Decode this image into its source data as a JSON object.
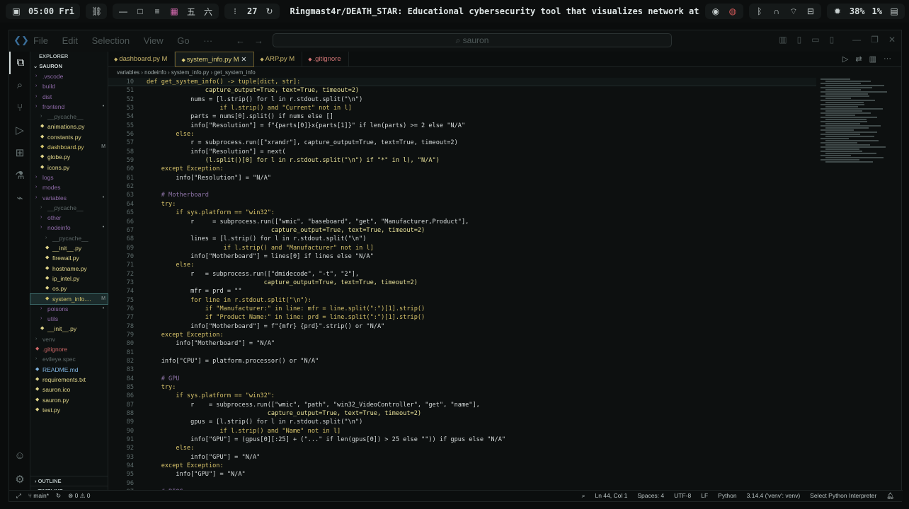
{
  "os_bar": {
    "clock": "05:00 Fri",
    "workspace_number": "27",
    "window_title": "Ringmast4r/DEATH_STAR: Educational cybersecurity tool that visualizes network at…",
    "brightness": "38%",
    "cpu": "1%"
  },
  "titlebar": {
    "menu": [
      "File",
      "Edit",
      "Selection",
      "View",
      "Go",
      "···"
    ],
    "search_text": "sauron"
  },
  "explorer": {
    "header": "EXPLORER",
    "root": "SAURON",
    "items": [
      {
        "label": ".vscode",
        "kind": "dir",
        "indent": 1,
        "mark": ""
      },
      {
        "label": "build",
        "kind": "dir",
        "indent": 1,
        "mark": ""
      },
      {
        "label": "dist",
        "kind": "dir",
        "indent": 1,
        "mark": ""
      },
      {
        "label": "frontend",
        "kind": "dir",
        "indent": 1,
        "mark": "•"
      },
      {
        "label": "__pycache__",
        "kind": "dim",
        "indent": 2,
        "mark": ""
      },
      {
        "label": "animations.py",
        "kind": "py",
        "indent": 2,
        "mark": ""
      },
      {
        "label": "constants.py",
        "kind": "py",
        "indent": 2,
        "mark": ""
      },
      {
        "label": "dashboard.py",
        "kind": "mod",
        "indent": 2,
        "mark": "M"
      },
      {
        "label": "globe.py",
        "kind": "py",
        "indent": 2,
        "mark": ""
      },
      {
        "label": "icons.py",
        "kind": "py",
        "indent": 2,
        "mark": ""
      },
      {
        "label": "logs",
        "kind": "dir",
        "indent": 1,
        "mark": ""
      },
      {
        "label": "modes",
        "kind": "dir",
        "indent": 1,
        "mark": ""
      },
      {
        "label": "variables",
        "kind": "dir",
        "indent": 1,
        "mark": "•"
      },
      {
        "label": "__pycache__",
        "kind": "dim",
        "indent": 2,
        "mark": ""
      },
      {
        "label": "other",
        "kind": "dir",
        "indent": 2,
        "mark": ""
      },
      {
        "label": "nodeinfo",
        "kind": "dir",
        "indent": 2,
        "mark": "•"
      },
      {
        "label": "__pycache__",
        "kind": "dim",
        "indent": 3,
        "mark": ""
      },
      {
        "label": "__init__.py",
        "kind": "py",
        "indent": 3,
        "mark": ""
      },
      {
        "label": "firewall.py",
        "kind": "py",
        "indent": 3,
        "mark": ""
      },
      {
        "label": "hostname.py",
        "kind": "py",
        "indent": 3,
        "mark": ""
      },
      {
        "label": "ip_intel.py",
        "kind": "py",
        "indent": 3,
        "mark": ""
      },
      {
        "label": "os.py",
        "kind": "py",
        "indent": 3,
        "mark": ""
      },
      {
        "label": "system_info....",
        "kind": "mod",
        "indent": 3,
        "mark": "M",
        "selected": true
      },
      {
        "label": "poisons",
        "kind": "dir",
        "indent": 2,
        "mark": "•"
      },
      {
        "label": "utils",
        "kind": "dir",
        "indent": 2,
        "mark": ""
      },
      {
        "label": "__init__.py",
        "kind": "py",
        "indent": 2,
        "mark": ""
      },
      {
        "label": "venv",
        "kind": "dim",
        "indent": 1,
        "mark": ""
      },
      {
        "label": ".gitignore",
        "kind": "git",
        "indent": 1,
        "mark": ""
      },
      {
        "label": "evileye.spec",
        "kind": "dim",
        "indent": 1,
        "mark": ""
      },
      {
        "label": "README.md",
        "kind": "md",
        "indent": 1,
        "mark": ""
      },
      {
        "label": "requirements.txt",
        "kind": "py",
        "indent": 1,
        "mark": ""
      },
      {
        "label": "sauron.ico",
        "kind": "py",
        "indent": 1,
        "mark": ""
      },
      {
        "label": "sauron.py",
        "kind": "py",
        "indent": 1,
        "mark": ""
      },
      {
        "label": "test.py",
        "kind": "py",
        "indent": 1,
        "mark": ""
      }
    ],
    "outline": "OUTLINE",
    "timeline": "TIMELINE"
  },
  "tabs": [
    {
      "label": "dashboard.py M",
      "kind": "mod",
      "active": false,
      "close": false
    },
    {
      "label": "system_info.py M",
      "kind": "mod",
      "active": true,
      "close": true
    },
    {
      "label": "ARP.py M",
      "kind": "mod",
      "active": false,
      "close": false
    },
    {
      "label": ".gitignore",
      "kind": "git",
      "active": false,
      "close": false
    }
  ],
  "breadcrumb": "variables › nodeinfo › system_info.py › get_system_info",
  "code": [
    {
      "n": "10",
      "t": "def get_system_info() -> tuple[dict, str]:",
      "sticky": true
    },
    {
      "n": "51",
      "t": "                capture_output=True, text=True, timeout=2)"
    },
    {
      "n": "52",
      "t": "            nums = [l.strip() for l in r.stdout.split(\"\\n\")"
    },
    {
      "n": "53",
      "t": "                    if l.strip() and \"Current\" not in l]"
    },
    {
      "n": "54",
      "t": "            parts = nums[0].split() if nums else []"
    },
    {
      "n": "55",
      "t": "            info[\"Resolution\"] = f\"{parts[0]}x{parts[1]}\" if len(parts) >= 2 else \"N/A\""
    },
    {
      "n": "56",
      "t": "        else:"
    },
    {
      "n": "57",
      "t": "            r = subprocess.run([\"xrandr\"], capture_output=True, text=True, timeout=2)"
    },
    {
      "n": "58",
      "t": "            info[\"Resolution\"] = next("
    },
    {
      "n": "59",
      "t": "                (l.split()[0] for l in r.stdout.split(\"\\n\") if \"*\" in l), \"N/A\")"
    },
    {
      "n": "60",
      "t": "    except Exception:"
    },
    {
      "n": "61",
      "t": "        info[\"Resolution\"] = \"N/A\""
    },
    {
      "n": "62",
      "t": ""
    },
    {
      "n": "63",
      "t": "    # Motherboard"
    },
    {
      "n": "64",
      "t": "    try:"
    },
    {
      "n": "65",
      "t": "        if sys.platform == \"win32\":"
    },
    {
      "n": "66",
      "t": "            r     = subprocess.run([\"wmic\", \"baseboard\", \"get\", \"Manufacturer,Product\"],"
    },
    {
      "n": "67",
      "t": "                                  capture_output=True, text=True, timeout=2)"
    },
    {
      "n": "68",
      "t": "            lines = [l.strip() for l in r.stdout.split(\"\\n\")"
    },
    {
      "n": "69",
      "t": "                     if l.strip() and \"Manufacturer\" not in l]"
    },
    {
      "n": "70",
      "t": "            info[\"Motherboard\"] = lines[0] if lines else \"N/A\""
    },
    {
      "n": "71",
      "t": "        else:"
    },
    {
      "n": "72",
      "t": "            r   = subprocess.run([\"dmidecode\", \"-t\", \"2\"],"
    },
    {
      "n": "73",
      "t": "                                capture_output=True, text=True, timeout=2)"
    },
    {
      "n": "74",
      "t": "            mfr = prd = \"\""
    },
    {
      "n": "75",
      "t": "            for line in r.stdout.split(\"\\n\"):"
    },
    {
      "n": "76",
      "t": "                if \"Manufacturer:\" in line: mfr = line.split(\":\")[1].strip()"
    },
    {
      "n": "77",
      "t": "                if \"Product Name:\" in line: prd = line.split(\":\")[1].strip()"
    },
    {
      "n": "78",
      "t": "            info[\"Motherboard\"] = f\"{mfr} {prd}\".strip() or \"N/A\""
    },
    {
      "n": "79",
      "t": "    except Exception:"
    },
    {
      "n": "80",
      "t": "        info[\"Motherboard\"] = \"N/A\""
    },
    {
      "n": "81",
      "t": ""
    },
    {
      "n": "82",
      "t": "    info[\"CPU\"] = platform.processor() or \"N/A\""
    },
    {
      "n": "83",
      "t": ""
    },
    {
      "n": "84",
      "t": "    # GPU"
    },
    {
      "n": "85",
      "t": "    try:"
    },
    {
      "n": "86",
      "t": "        if sys.platform == \"win32\":"
    },
    {
      "n": "87",
      "t": "            r    = subprocess.run([\"wmic\", \"path\", \"win32_VideoController\", \"get\", \"name\"],"
    },
    {
      "n": "88",
      "t": "                                 capture_output=True, text=True, timeout=2)"
    },
    {
      "n": "89",
      "t": "            gpus = [l.strip() for l in r.stdout.split(\"\\n\")"
    },
    {
      "n": "90",
      "t": "                    if l.strip() and \"Name\" not in l]"
    },
    {
      "n": "91",
      "t": "            info[\"GPU\"] = (gpus[0][:25] + (\"...\" if len(gpus[0]) > 25 else \"\")) if gpus else \"N/A\""
    },
    {
      "n": "92",
      "t": "        else:"
    },
    {
      "n": "93",
      "t": "            info[\"GPU\"] = \"N/A\""
    },
    {
      "n": "94",
      "t": "    except Exception:"
    },
    {
      "n": "95",
      "t": "        info[\"GPU\"] = \"N/A\""
    },
    {
      "n": "96",
      "t": ""
    },
    {
      "n": "97",
      "t": "    # BIOS"
    }
  ],
  "status": {
    "branch": "main*",
    "problems": "⊗ 0 ⚠ 0",
    "position": "Ln 44, Col 1",
    "spaces": "Spaces: 4",
    "encoding": "UTF-8",
    "eol": "LF",
    "language": "Python",
    "interpreter_version": "3.14.4 ('venv': venv)",
    "interpreter": "Select Python Interpreter"
  },
  "colors": {
    "keyword": "#d7c36a",
    "string": "#e9e29a",
    "comment": "#8d73a6",
    "accent": "#3c6a6a"
  }
}
